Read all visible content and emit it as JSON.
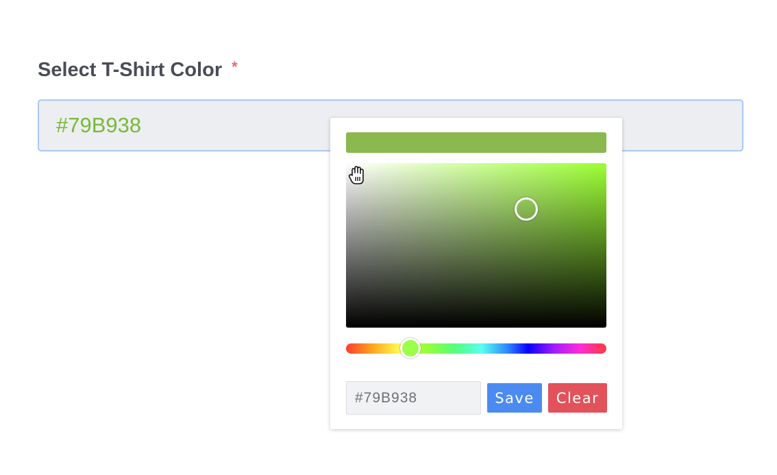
{
  "form": {
    "label": "Select T-Shirt Color",
    "required_mark": "*",
    "value": "#79B938"
  },
  "picker": {
    "preview_color": "#8BB84F",
    "hue_color": "#9CFF33",
    "hex_value": "#79B938",
    "save_label": "Save",
    "clear_label": "Clear"
  },
  "colors": {
    "input_text": "#79B938",
    "input_border": "#A9C8F4",
    "save_button": "#4B8BF1",
    "clear_button": "#E2525B",
    "required": "#E86A6F"
  },
  "icons": {
    "cursor": "grab-hand-icon"
  }
}
